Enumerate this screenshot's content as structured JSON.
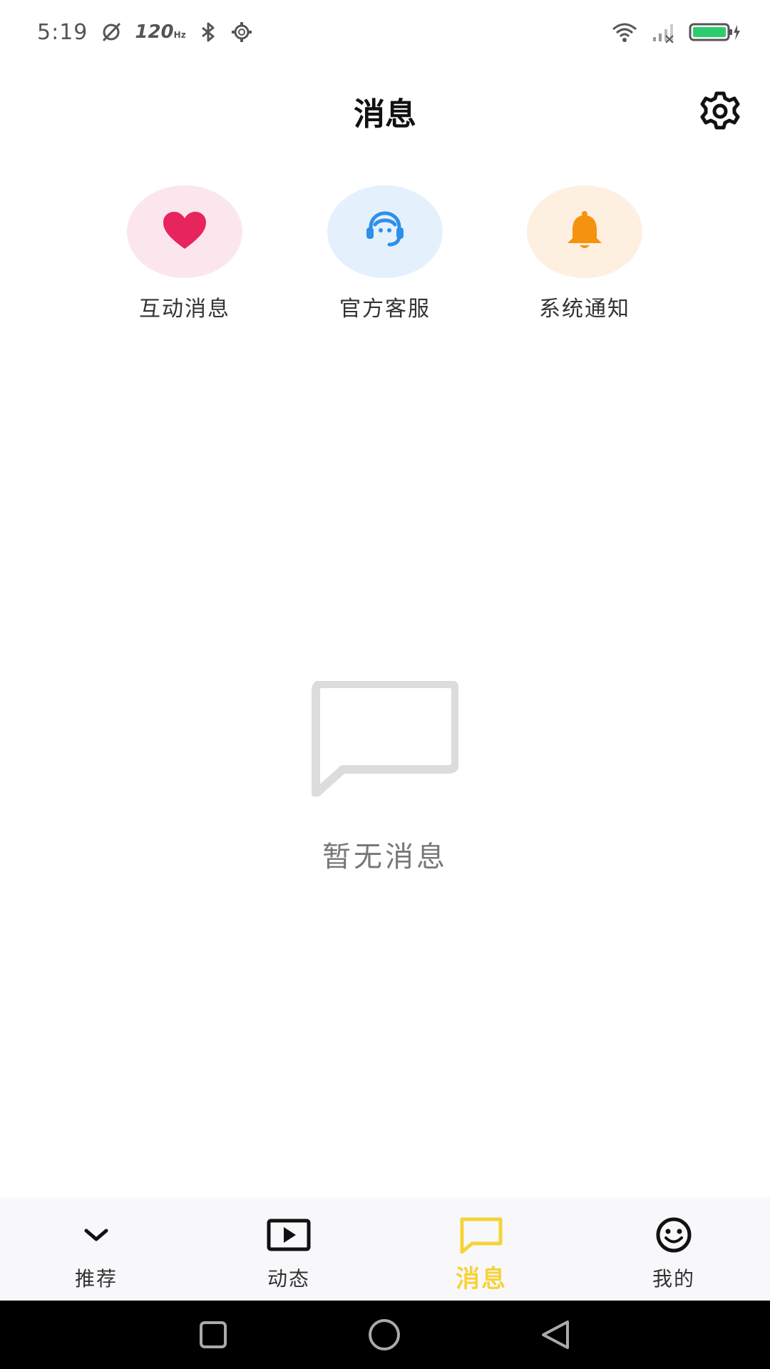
{
  "status_bar": {
    "time": "5:19",
    "refresh_rate": "120",
    "refresh_unit": "Hz",
    "icons": [
      "mute-icon",
      "bluetooth-icon",
      "settings-gear-icon",
      "wifi-icon",
      "signal-icon",
      "battery-icon"
    ]
  },
  "header": {
    "title": "消息",
    "settings_icon": "gear-icon"
  },
  "shortcuts": [
    {
      "label": "互动消息",
      "icon": "heart-icon",
      "bg": "#fce6ee",
      "color": "#e8245f"
    },
    {
      "label": "官方客服",
      "icon": "headset-icon",
      "bg": "#e4f1fd",
      "color": "#2f8fe8"
    },
    {
      "label": "系统通知",
      "icon": "bell-icon",
      "bg": "#fdf0e0",
      "color": "#f5920f"
    }
  ],
  "empty_state": {
    "icon": "chat-bubble-icon",
    "text": "暂无消息"
  },
  "tab_bar": {
    "active_color": "#f5d33a",
    "tabs": [
      {
        "label": "推荐",
        "icon": "chevron-down-icon",
        "active": false
      },
      {
        "label": "动态",
        "icon": "play-video-icon",
        "active": false
      },
      {
        "label": "消息",
        "icon": "message-icon",
        "active": true
      },
      {
        "label": "我的",
        "icon": "smiley-icon",
        "active": false
      }
    ]
  },
  "nav_bar": {
    "buttons": [
      "recent-apps-icon",
      "home-icon",
      "back-icon"
    ]
  }
}
